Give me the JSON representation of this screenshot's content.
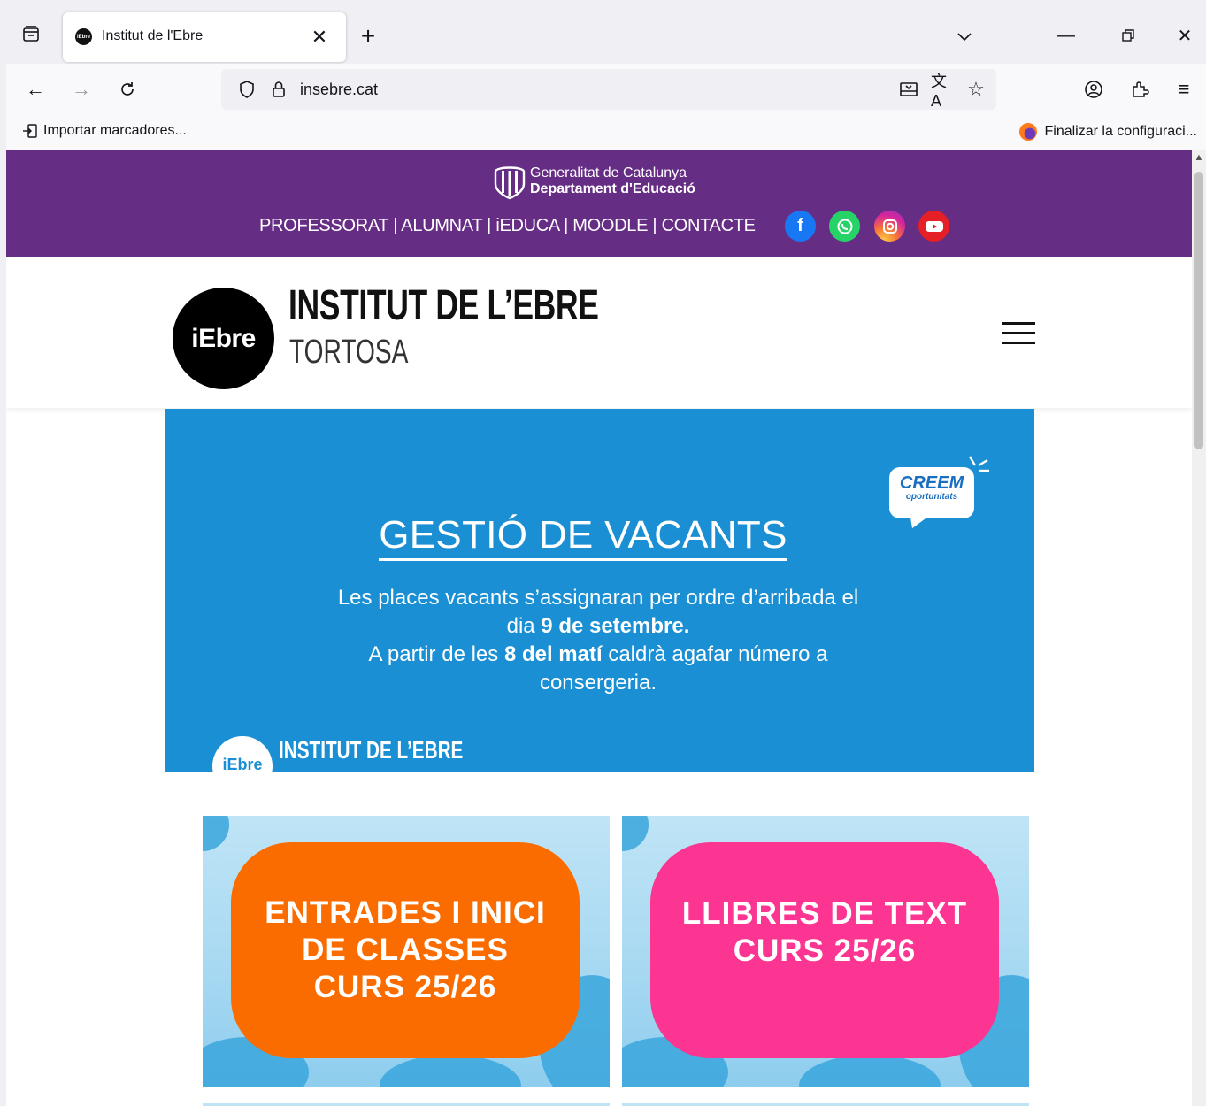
{
  "browser": {
    "tab_title": "Institut de l'Ebre",
    "favicon_text": "iEbre",
    "url": "insebre.cat",
    "bookmark_import": "Importar marcadores...",
    "bookmark_finish": "Finalizar la configuraci..."
  },
  "topbar": {
    "gencat_line1": "Generalitat de Catalunya",
    "gencat_line2": "Departament d'Educació",
    "nav": "PROFESSORAT | ALUMNAT | iEDUCA | MOODLE | CONTACTE",
    "social": [
      "facebook",
      "whatsapp",
      "instagram",
      "youtube"
    ],
    "color": "#662d85"
  },
  "header": {
    "logo_text": "iEbre",
    "title": "INSTITUT DE L’EBRE",
    "subtitle": "TORTOSA"
  },
  "banner": {
    "creem_title": "CREEM",
    "creem_sub": "oportunitats",
    "title": "GESTIÓ DE VACANTS",
    "line1": "Les places vacants s’assignaran per ordre d’arribada el",
    "line2_pre": "dia ",
    "line2_bold": "9 de setembre.",
    "line3_pre": "A partir de les ",
    "line3_bold": "8 del matí",
    "line3_post": " caldrà agafar número a",
    "line4": "consergeria.",
    "mini_logo": "iEbre",
    "mini_title": "INSTITUT DE L’EBRE",
    "color": "#1a8fd3"
  },
  "cards": [
    {
      "text": "ENTRADES I INICI\nDE CLASSES\nCURS 25/26",
      "color": "#fb6c00"
    },
    {
      "text": "LLIBRES DE TEXT\nCURS 25/26",
      "color": "#fb3591"
    }
  ]
}
